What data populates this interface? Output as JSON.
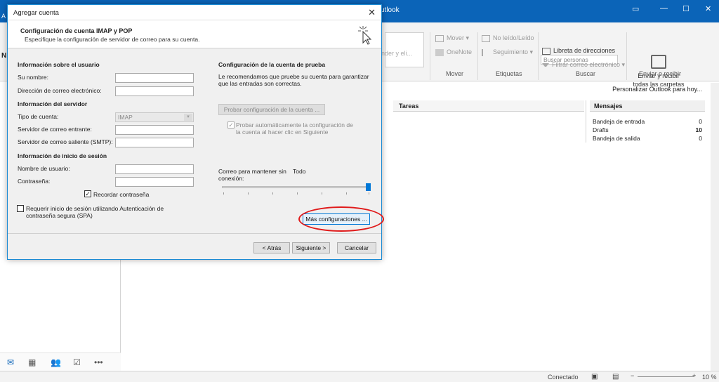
{
  "outlook": {
    "app_title": "utlook",
    "window_icons": [
      "restore-icon",
      "minimize-icon",
      "maximize-icon",
      "close-icon"
    ],
    "ribbon": {
      "reply_text": "onder y eli...",
      "mover_label": "Mover",
      "onenote_label": "OneNote",
      "group_mover": "Mover",
      "unread_label": "No leído/Leído",
      "followup_label": "Seguimiento",
      "group_etiquetas": "Etiquetas",
      "search_placeholder": "Buscar personas",
      "address_book": "Libreta de direcciones",
      "filter_email": "Filtrar correo electrónico",
      "group_buscar": "Buscar",
      "send_receive_line1": "Enviar y recibir",
      "send_receive_line2": "todas las carpetas",
      "group_enviar": "Enviar o recibir"
    },
    "left_letters": [
      "N",
      "A"
    ],
    "personalize": "Personalizar Outlook para hoy...",
    "tareas_title": "Tareas",
    "mensajes_title": "Mensajes",
    "mensajes": [
      {
        "name": "Bandeja de entrada",
        "count": "0"
      },
      {
        "name": "Drafts",
        "count": "10"
      },
      {
        "name": "Bandeja de salida",
        "count": "0"
      }
    ],
    "status_connected": "Conectado",
    "zoom": "10 %",
    "accent": "#0b64b8"
  },
  "dialog": {
    "title": "Agregar cuenta",
    "header_title": "Configuración de cuenta IMAP y POP",
    "header_subtitle": "Especifique la configuración de servidor de correo para su cuenta.",
    "user_info_title": "Información sobre el usuario",
    "name_label": "Su nombre:",
    "email_label": "Dirección de correo electrónico:",
    "server_info_title": "Información del servidor",
    "account_type_label": "Tipo de cuenta:",
    "account_type_value": "IMAP",
    "incoming_label": "Servidor de correo entrante:",
    "outgoing_label": "Servidor de correo saliente (SMTP):",
    "login_info_title": "Información de inicio de sesión",
    "username_label": "Nombre de usuario:",
    "password_label": "Contraseña:",
    "remember_password": "Recordar contraseña",
    "spa_line1": "Requerir inicio de sesión utilizando Autenticación de",
    "spa_line2": "contraseña segura (SPA)",
    "test_title": "Configuración de la cuenta de prueba",
    "test_desc1": "Le recomendamos que pruebe su cuenta para garantizar",
    "test_desc2": "que las entradas son correctas.",
    "test_button": "Probar configuración de la cuenta ...",
    "auto_test1": "Probar automáticamente la configuración de",
    "auto_test2": "la cuenta al hacer clic en Siguiente",
    "offline_label1": "Correo para mantener sin",
    "offline_label2": "conexión:",
    "offline_value": "Todo",
    "more_settings": "Más configuraciones ...",
    "back_button": "< Atrás",
    "next_button": "Siguiente >",
    "cancel_button": "Cancelar",
    "remember_checked": true,
    "spa_checked": false,
    "auto_test_checked": true,
    "offline_slider_level": 1.0,
    "highlight_color": "#e01a1a"
  }
}
